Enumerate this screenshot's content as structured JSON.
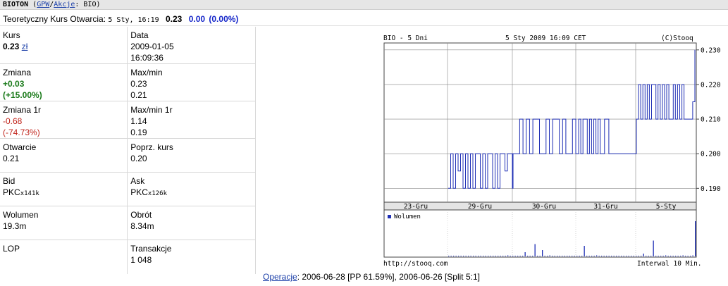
{
  "topbar": {
    "name": "BIOTON",
    "open_paren": "(",
    "link_gpw": "GPW",
    "sep": "/",
    "link_akcje": "Akcje",
    "tail": ": BIO)"
  },
  "quote": {
    "label": "Teoretyczny Kurs Otwarcia:",
    "datetime": "5 Sty, 16:19",
    "last": "0.23",
    "change": "0.00",
    "change_pct": "(0.00%)"
  },
  "grid": {
    "kurs_label": "Kurs",
    "kurs_value": "0.23",
    "kurs_currency": "zł",
    "data_label": "Data",
    "data_date": "2009-01-05",
    "data_time": "16:09:36",
    "zmiana_label": "Zmiana",
    "zmiana_value": "+0.03",
    "zmiana_pct": "(+15.00%)",
    "maxmin_label": "Max/min",
    "max_value": "0.23",
    "min_value": "0.21",
    "zmiana1r_label": "Zmiana 1r",
    "zmiana1r_value": "-0.68",
    "zmiana1r_pct": "(-74.73%)",
    "maxmin1r_label": "Max/min 1r",
    "max1r_value": "1.14",
    "min1r_value": "0.19",
    "otwarcie_label": "Otwarcie",
    "otwarcie_value": "0.21",
    "poprz_label": "Poprz. kurs",
    "poprz_value": "0.20",
    "bid_label": "Bid",
    "bid_value": "PKC",
    "bid_sub": "x141k",
    "ask_label": "Ask",
    "ask_value": "PKC",
    "ask_sub": "x126k",
    "wolumen_label": "Wolumen",
    "wolumen_value": "19.3m",
    "obrot_label": "Obrót",
    "obrot_value": "8.34m",
    "lop_label": "LOP",
    "transakcje_label": "Transakcje",
    "transakcje_value": "1 048"
  },
  "chart": {
    "title_left": "BIO - 5 Dni",
    "title_center": "5 Sty 2009 16:09 CET",
    "title_right": "(C)Stooq",
    "footer_left": "http://stooq.com",
    "footer_right": "Interwal 10 Min.",
    "volume_legend": "Wolumen",
    "line_color": "#1f2fb5"
  },
  "chart_data": {
    "type": "line",
    "ylim": [
      0.186,
      0.232
    ],
    "yticks": [
      "0.230",
      "0.220",
      "0.210",
      "0.200",
      "0.190"
    ],
    "yticks_values": [
      0.23,
      0.22,
      0.21,
      0.2,
      0.19
    ],
    "categories": [
      "23-Gru",
      "29-Gru",
      "30-Gru",
      "31-Gru",
      "5-Sty"
    ],
    "segments": [
      {
        "day": "23-Gru",
        "values": [
          0.19,
          0.2,
          0.19,
          0.2,
          0.195,
          0.2,
          0.19,
          0.2,
          0.19,
          0.2,
          0.19,
          0.2,
          0.2,
          0.19,
          0.2,
          0.19,
          0.2,
          0.2,
          0.19,
          0.2,
          0.19,
          0.2,
          0.2,
          0.195,
          0.2,
          0.2,
          0.19
        ]
      },
      {
        "day": "29-Gru",
        "values": [
          0.2,
          0.2,
          0.21,
          0.2,
          0.21,
          0.2,
          0.21,
          0.21,
          0.2,
          0.2,
          0.21,
          0.2,
          0.21,
          0.21,
          0.2,
          0.21,
          0.2,
          0.2,
          0.21,
          0.2
        ]
      },
      {
        "day": "30-Gru",
        "values": [
          0.2,
          0.21,
          0.2,
          0.21,
          0.21,
          0.2,
          0.21,
          0.2,
          0.21,
          0.2,
          0.21,
          0.2,
          0.2,
          0.21,
          0.21,
          0.2,
          0.2
        ]
      },
      {
        "day": "31-Gru",
        "values": [
          0.2,
          0.2
        ]
      },
      {
        "day": "5-Sty",
        "values": [
          0.21,
          0.22,
          0.21,
          0.22,
          0.21,
          0.22,
          0.21,
          0.22,
          0.22,
          0.21,
          0.22,
          0.21,
          0.22,
          0.21,
          0.22,
          0.21,
          0.21,
          0.22,
          0.21,
          0.22,
          0.21,
          0.22,
          0.21,
          0.21,
          0.21,
          0.21,
          0.215,
          0.23
        ]
      }
    ],
    "volume": [
      0.02,
      0.01,
      0.01,
      0.02,
      0.01,
      0.01,
      0.02,
      0.01,
      0.01,
      0.01,
      0.02,
      0.01,
      0.01,
      0.02,
      0.01,
      0.01,
      0.01,
      0.02,
      0.01,
      0.01,
      0.01,
      0.02,
      0.01,
      0.01,
      0.03,
      0.01,
      0.02,
      0.01,
      0.01,
      0.02,
      0.01,
      0.12,
      0.02,
      0.01,
      0.01,
      0.35,
      0.02,
      0.01,
      0.18,
      0.01,
      0.02,
      0.03,
      0.02,
      0.01,
      0.02,
      0.01,
      0.02,
      0.01,
      0.01,
      0.02,
      0.01,
      0.01,
      0.02,
      0.01,
      0.01,
      0.3,
      0.02,
      0.01,
      0.02,
      0.01,
      0.03,
      0.01,
      0.02,
      0.01,
      0.01,
      0.02,
      0.01,
      0.01,
      0.01,
      0.02,
      0.01,
      0.01,
      0.02,
      0.01,
      0.01,
      0.01,
      0.02,
      0.01,
      0.01,
      0.08,
      0.01,
      0.02,
      0.01,
      0.45,
      0.02,
      0.01,
      0.02,
      0.01,
      0.03,
      0.01,
      0.02,
      0.01,
      0.02,
      0.01,
      0.01,
      0.03,
      0.02,
      0.01,
      0.02,
      0.03,
      1.0
    ]
  },
  "operacje": {
    "label": "Operacje",
    "text": ": 2006-06-28 [PP 61.59%], 2006-06-26 [Split 5:1]"
  }
}
